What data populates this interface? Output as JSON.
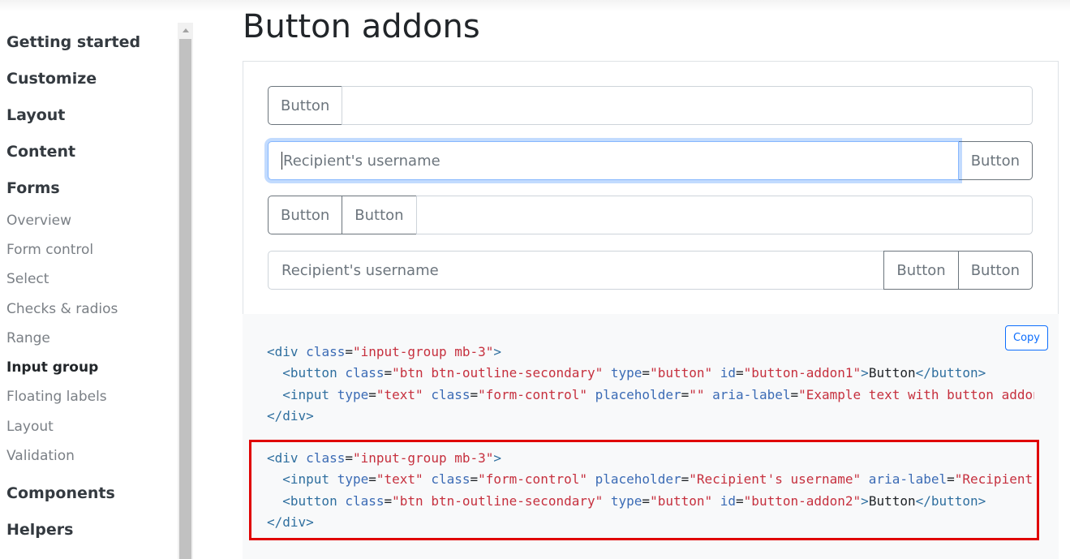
{
  "sidebar": {
    "sections": [
      {
        "label": "Getting started"
      },
      {
        "label": "Customize"
      },
      {
        "label": "Layout"
      },
      {
        "label": "Content"
      },
      {
        "label": "Forms"
      },
      {
        "label": "Components"
      },
      {
        "label": "Helpers"
      }
    ],
    "forms_links": [
      {
        "label": "Overview"
      },
      {
        "label": "Form control"
      },
      {
        "label": "Select"
      },
      {
        "label": "Checks & radios"
      },
      {
        "label": "Range"
      },
      {
        "label": "Input group",
        "active": true
      },
      {
        "label": "Floating labels"
      },
      {
        "label": "Layout"
      },
      {
        "label": "Validation"
      }
    ]
  },
  "page": {
    "title": "Button addons"
  },
  "example": {
    "button_label": "Button",
    "recipient_placeholder": "Recipient's username"
  },
  "code": {
    "copy_label": "Copy"
  }
}
